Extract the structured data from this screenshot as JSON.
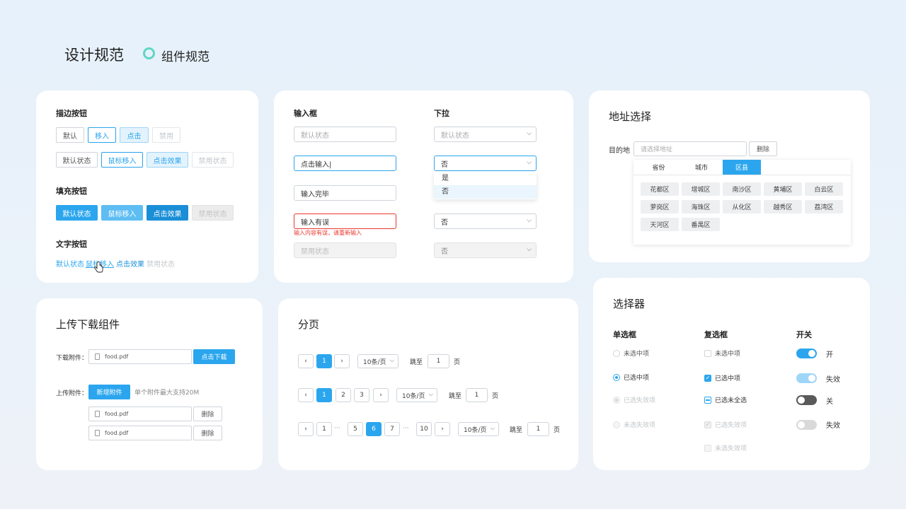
{
  "header": {
    "title": "设计规范",
    "subtitle": "组件规范",
    "accent": "#5fd6c4"
  },
  "buttons": {
    "outline_title": "描边按钮",
    "outline_small": [
      "默认",
      "移入",
      "点击",
      "禁用"
    ],
    "outline_large": [
      "默认状态",
      "鼠标移入",
      "点击效果",
      "禁用状态"
    ],
    "fill_title": "填充按钮",
    "fill": [
      "默认状态",
      "鼠标移入",
      "点击效果",
      "禁用状态"
    ],
    "text_title": "文字按钮",
    "text": [
      "默认状态",
      "鼠标移入",
      "点击效果",
      "禁用状态"
    ]
  },
  "inputs": {
    "input_title": "输入框",
    "select_title": "下拉",
    "i_default": "默认状态",
    "i_typing": "点击输入|",
    "i_done": "输入完毕",
    "i_error": "输入有误",
    "i_error_msg": "输入内容有误，请重新输入",
    "i_disabled": "禁用状态",
    "s_default": "默认状态",
    "s_open": "否",
    "s_options": [
      "是",
      "否"
    ],
    "s_third": "否",
    "s_disabled": "否"
  },
  "address": {
    "title": "地址选择",
    "label": "目的地",
    "placeholder": "请选择地址",
    "delete": "删除",
    "tabs": [
      "省份",
      "城市",
      "区县"
    ],
    "districts": [
      "花都区",
      "增城区",
      "南沙区",
      "黄埔区",
      "白云区",
      "萝岗区",
      "海珠区",
      "从化区",
      "越秀区",
      "荔湾区",
      "天河区",
      "番禺区"
    ]
  },
  "upload": {
    "title": "上传下载组件",
    "download_label": "下载附件：",
    "download_file": "food.pdf",
    "download_button": "点击下载",
    "upload_label": "上传附件：",
    "upload_button": "新增附件",
    "upload_hint": "单个附件最大支持20M",
    "files": [
      {
        "name": "food.pdf",
        "action": "删除"
      },
      {
        "name": "food.pdf",
        "action": "删除"
      }
    ]
  },
  "pagination": {
    "title": "分页",
    "prev": "‹",
    "next": "›",
    "ellipsis": "···",
    "row1": {
      "pages": [
        "1"
      ],
      "size": "10条/页",
      "jump": "跳至",
      "value": "1",
      "unit": "页"
    },
    "row2": {
      "pages": [
        "1",
        "2",
        "3"
      ],
      "size": "10条/页",
      "jump": "跳至",
      "value": "1",
      "unit": "页"
    },
    "row3": {
      "pages": [
        "1",
        "5",
        "6",
        "7",
        "10"
      ],
      "size": "10条/页",
      "jump": "跳至",
      "value": "1",
      "unit": "页"
    }
  },
  "selector": {
    "title": "选择器",
    "radio_title": "单选框",
    "radios": [
      "未选中项",
      "已选中项",
      "已选失效项",
      "未选失效项"
    ],
    "check_title": "复选框",
    "checks": [
      "未选中项",
      "已选中项",
      "已选未全选",
      "已选失效项",
      "未选失效项"
    ],
    "switch_title": "开关",
    "switches": [
      "开",
      "失效",
      "关",
      "失效"
    ]
  },
  "colors": {
    "primary": "#2ba6ee",
    "error": "#e8382f"
  }
}
